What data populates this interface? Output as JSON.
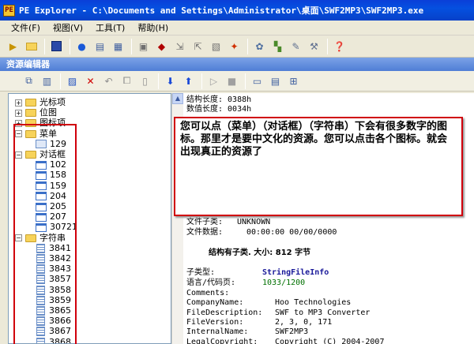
{
  "window": {
    "title": "PE Explorer - C:\\Documents and Settings\\Administrator\\桌面\\SWF2MP3\\SWF2MP3.exe"
  },
  "menu": {
    "items": [
      "文件(F)",
      "视图(V)",
      "工具(T)",
      "帮助(H)"
    ]
  },
  "toolbar_icons": [
    "open-icon",
    "folder-icon",
    "save-icon",
    "info-icon",
    "headers-icon",
    "sections-icon",
    "resources-icon",
    "disasm-icon",
    "imports-icon",
    "exports-icon",
    "dependency-icon",
    "settings-icon",
    "plugins-icon",
    "tools-icon",
    "help-icon"
  ],
  "panel_header": "资源编辑器",
  "tree": {
    "top_items": [
      "光标项",
      "位图",
      "图标项"
    ],
    "menu_folder": "菜单",
    "menu_items": [
      "129"
    ],
    "dialog_folder": "对话框",
    "dialog_items": [
      "102",
      "158",
      "159",
      "204",
      "205",
      "207",
      "30721"
    ],
    "string_folder": "字符串",
    "string_items": [
      "3841",
      "3842",
      "3843",
      "3857",
      "3858",
      "3859",
      "3865",
      "3866",
      "3867",
      "3868"
    ]
  },
  "detail": {
    "struct_length": "结构长度: 0388h",
    "value_length": "数值长度: 0034h",
    "file_type_label": "文件子类:",
    "file_type_value": "UNKNOWN",
    "file_data_label": "文件数据:",
    "file_data_value": "00:00:00  00/00/0000",
    "struct_info": "结构有子类. 大小: 812 字节",
    "subtype_label": "子类型:",
    "subtype_value": "StringFileInfo",
    "lang_label": "语言/代码页:",
    "lang_value": "1033/1200",
    "rows": [
      {
        "k": "Comments:",
        "v": ""
      },
      {
        "k": "CompanyName:",
        "v": "Hoo Technologies"
      },
      {
        "k": "FileDescription:",
        "v": "SWF to MP3 Converter"
      },
      {
        "k": "FileVersion:",
        "v": "2, 3, 0, 171"
      },
      {
        "k": "InternalName:",
        "v": "SWF2MP3"
      },
      {
        "k": "LegalCopyright:",
        "v": "Copyright (C) 2004-2007"
      }
    ]
  },
  "callout": {
    "text": "您可以点（菜单）（对话框）（字符串）下会有很多数字的图标。那里才是要中文化的资源。您可以点击各个图标。就会出现真正的资源了"
  },
  "colors": {
    "titlebar": "#0550e0",
    "highlight": "#d0000b"
  }
}
